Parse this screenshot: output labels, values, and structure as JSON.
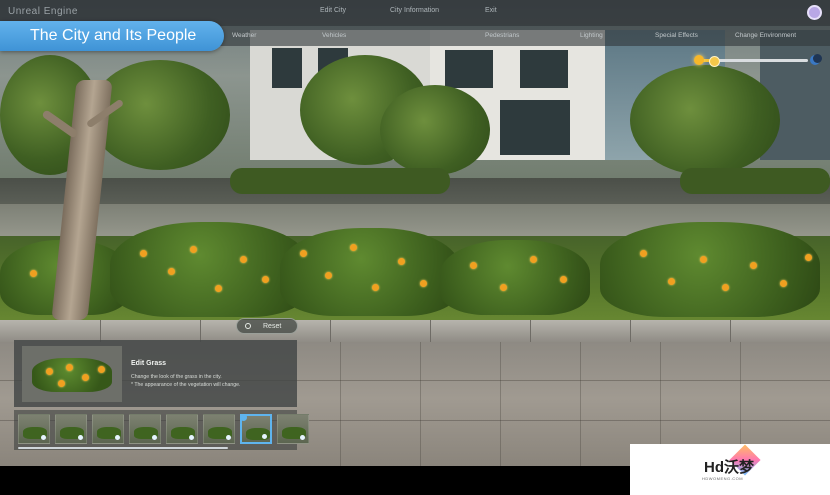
{
  "app": {
    "brand": "Unreal Engine",
    "nav": [
      "Edit City",
      "City Information",
      "Exit"
    ],
    "avatar": "user-avatar-icon"
  },
  "subnav": [
    "Weather",
    "Vehicles",
    "Pedestrians",
    "Lighting",
    "Special Effects",
    "Change Environment"
  ],
  "title": "The City and Its People",
  "time_of_day": {
    "start_icon": "sun-icon",
    "end_icon": "moon-icon",
    "level": 0.1
  },
  "reset": {
    "label": "Reset",
    "icon": "reset-icon"
  },
  "panel": {
    "title": "Edit Grass",
    "description_line1": "Change the look of the grass in the city.",
    "description_line2": "* The appearance of the vegetation will change."
  },
  "thumbnails": {
    "count": 8,
    "selected_index": 6
  },
  "watermark": {
    "logo": "Hd沃梦",
    "sub": "HDWOMENG.COM"
  },
  "colors": {
    "accent": "#4fa3e2",
    "flower": "#f0a020"
  }
}
